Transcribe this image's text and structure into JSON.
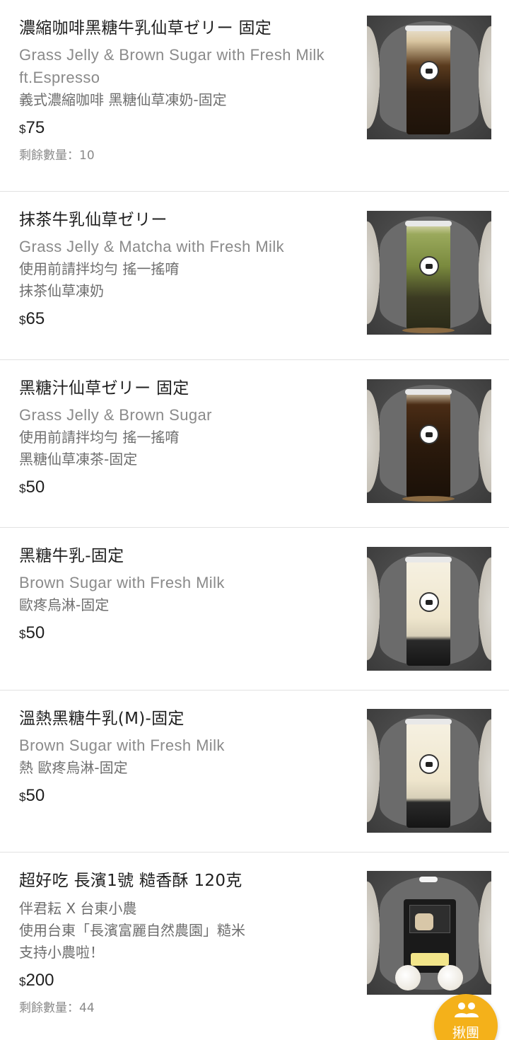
{
  "menu_items": [
    {
      "title": "濃縮咖啡黑糖牛乳仙草ゼリー 固定",
      "subtitle_en": "Grass Jelly & Brown Sugar with Fresh Milk ft.Espresso",
      "description": [
        "義式濃縮咖啡 黑糖仙草凍奶-固定"
      ],
      "currency": "$",
      "price": "75",
      "remaining": "剩餘數量：10"
    },
    {
      "title": "抹茶牛乳仙草ゼリー",
      "subtitle_en": "Grass Jelly & Matcha with Fresh Milk",
      "description": [
        "使用前請拌均勻 搖一搖唷",
        "抹茶仙草凍奶"
      ],
      "currency": "$",
      "price": "65"
    },
    {
      "title": "黑糖汁仙草ゼリー 固定",
      "subtitle_en": "Grass Jelly & Brown Sugar",
      "description": [
        "使用前請拌均勻 搖一搖唷",
        "黑糖仙草凍茶-固定"
      ],
      "currency": "$",
      "price": "50"
    },
    {
      "title": "黑糖牛乳-固定",
      "subtitle_en": "Brown Sugar with Fresh Milk",
      "description": [
        "歐疼烏淋-固定"
      ],
      "currency": "$",
      "price": "50"
    },
    {
      "title": "溫熱黑糖牛乳(M)-固定",
      "subtitle_en": "Brown Sugar with Fresh Milk",
      "description": [
        "熱 歐疼烏淋-固定"
      ],
      "currency": "$",
      "price": "50"
    },
    {
      "title": "超好吃 長濱1號 糙香酥 120克",
      "description": [
        "伴君耘 X 台東小農",
        "使用台東「長濱富麗自然農園」糙米",
        "支持小農啦！"
      ],
      "currency": "$",
      "price": "200",
      "remaining": "剩餘數量：44"
    }
  ],
  "fab": {
    "label": "揪團",
    "icon": "group-icon",
    "color": "#f4b11a"
  }
}
